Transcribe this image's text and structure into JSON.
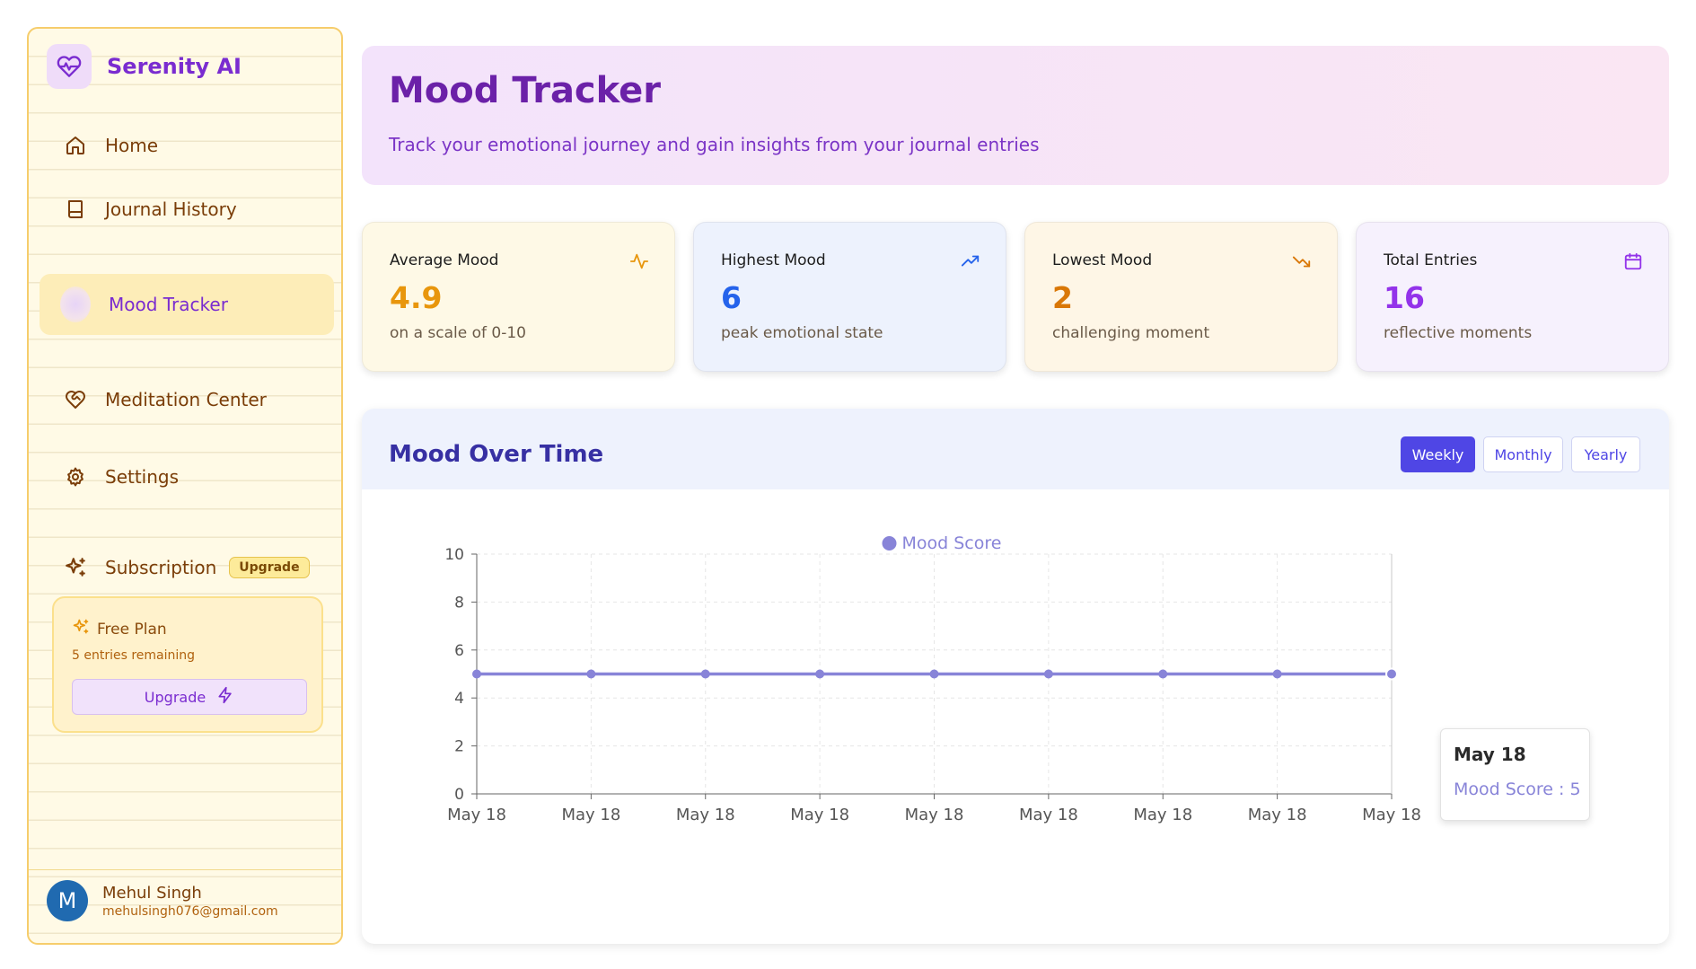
{
  "app": {
    "brand_name": "Serenity AI",
    "brand_icon": "heart-pulse-icon"
  },
  "sidebar": {
    "items": [
      {
        "label": "Home",
        "icon": "home-icon"
      },
      {
        "label": "Journal History",
        "icon": "book-icon"
      },
      {
        "label": "Mood Tracker",
        "icon": "mood-icon",
        "active": true
      },
      {
        "label": "Meditation Center",
        "icon": "heart-handshake-icon"
      },
      {
        "label": "Settings",
        "icon": "gear-icon"
      }
    ],
    "subscription": {
      "label": "Subscription",
      "badge": "Upgrade",
      "icon": "sparkles-icon"
    },
    "plan": {
      "title": "Free Plan",
      "remaining": "5 entries remaining",
      "button_label": "Upgrade"
    },
    "user": {
      "initial": "M",
      "name": "Mehul Singh",
      "email": "mehulsingh076@gmail.com"
    }
  },
  "header": {
    "title": "Mood Tracker",
    "subtitle": "Track your emotional journey and gain insights from your journal entries"
  },
  "stats": [
    {
      "title": "Average Mood",
      "value": "4.9",
      "desc": "on a scale of 0-10",
      "icon": "activity-icon",
      "color": "#e8960c",
      "bg": "#fef9e6"
    },
    {
      "title": "Highest Mood",
      "value": "6",
      "desc": "peak emotional state",
      "icon": "trending-up-icon",
      "color": "#2563eb",
      "bg": "#edf2fd"
    },
    {
      "title": "Lowest Mood",
      "value": "2",
      "desc": "challenging moment",
      "icon": "trending-down-icon",
      "color": "#d97706",
      "bg": "#fef6e6"
    },
    {
      "title": "Total Entries",
      "value": "16",
      "desc": "reflective moments",
      "icon": "calendar-icon",
      "color": "#9333ea",
      "bg": "#f6f1fd"
    }
  ],
  "chart_panel": {
    "title": "Mood Over Time",
    "ranges": [
      "Weekly",
      "Monthly",
      "Yearly"
    ],
    "selected_range": "Weekly",
    "accent": "#4f46e5",
    "tooltip": {
      "title": "May 18",
      "label": "Mood Score : 5"
    }
  },
  "chart_data": {
    "type": "line",
    "x": [
      "May 18",
      "May 18",
      "May 18",
      "May 18",
      "May 18",
      "May 18",
      "May 18",
      "May 18",
      "May 18"
    ],
    "series": [
      {
        "name": "Mood Score",
        "values": [
          5,
          5,
          5,
          5,
          5,
          5,
          5,
          5,
          5
        ],
        "color": "#8884d8"
      }
    ],
    "yticks": [
      0,
      2,
      4,
      6,
      8,
      10
    ],
    "ylim": [
      0,
      10
    ],
    "grid": true,
    "legend": "top-center"
  }
}
